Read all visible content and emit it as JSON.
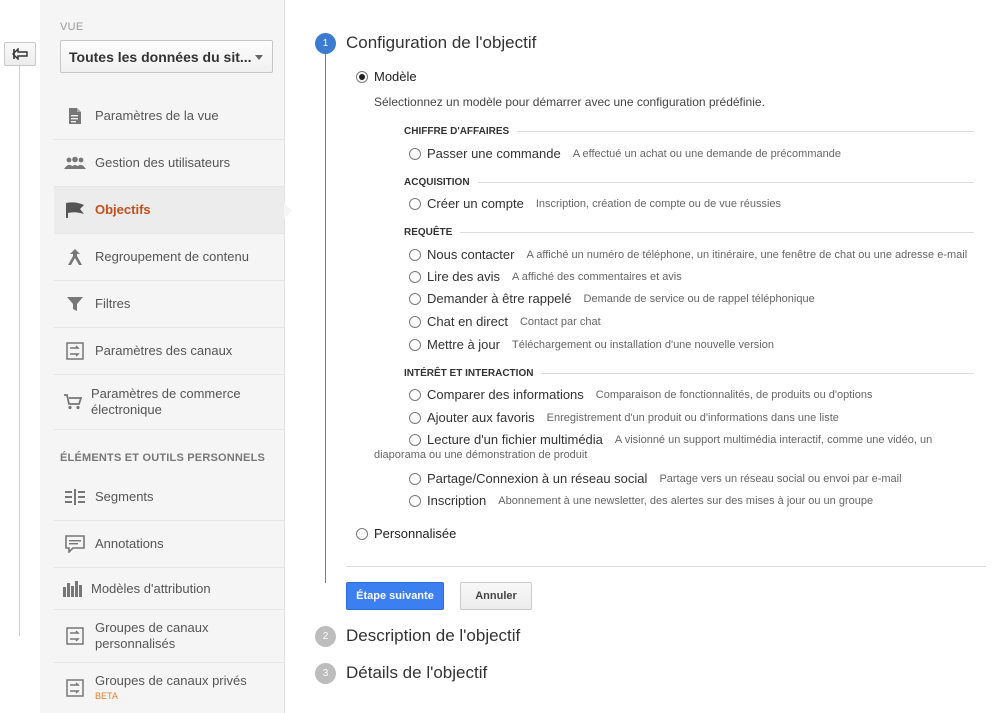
{
  "sidebar": {
    "view_label": "VUE",
    "view_value": "Toutes les données du sit...",
    "items": [
      {
        "label": "Paramètres de la vue",
        "icon": "document-icon"
      },
      {
        "label": "Gestion des utilisateurs",
        "icon": "users-icon"
      },
      {
        "label": "Objectifs",
        "icon": "flag-icon"
      },
      {
        "label": "Regroupement de contenu",
        "icon": "merge-icon"
      },
      {
        "label": "Filtres",
        "icon": "filter-icon"
      },
      {
        "label": "Paramètres des canaux",
        "icon": "channels-icon"
      },
      {
        "label": "Paramètres de commerce électronique",
        "icon": "cart-icon"
      }
    ],
    "section_title": "ÉLÉMENTS ET OUTILS PERSONNELS",
    "tools": [
      {
        "label": "Segments",
        "icon": "segments-icon"
      },
      {
        "label": "Annotations",
        "icon": "annotation-icon"
      },
      {
        "label": "Modèles d'attribution",
        "icon": "bar-chart-icon"
      },
      {
        "label": "Groupes de canaux personnalisés",
        "icon": "channels-icon"
      },
      {
        "label": "Groupes de canaux privés",
        "icon": "channels-icon",
        "badge": "BETA"
      }
    ]
  },
  "steps": [
    {
      "num": "1",
      "title": "Configuration de l'objectif"
    },
    {
      "num": "2",
      "title": "Description de l'objectif"
    },
    {
      "num": "3",
      "title": "Détails de l'objectif"
    }
  ],
  "config": {
    "template_label": "Modèle",
    "intro": "Sélectionnez un modèle pour démarrer avec une configuration prédéfinie.",
    "categories": [
      {
        "title": "CHIFFRE D'AFFAIRES",
        "items": [
          {
            "name": "Passer une commande",
            "desc": "A effectué un achat ou une demande de précommande"
          }
        ]
      },
      {
        "title": "ACQUISITION",
        "items": [
          {
            "name": "Créer un compte",
            "desc": "Inscription, création de compte ou de vue réussies"
          }
        ]
      },
      {
        "title": "REQUÊTE",
        "items": [
          {
            "name": "Nous contacter",
            "desc": "A affiché un numéro de téléphone, un itinéraire, une fenêtre de chat ou une adresse e-mail"
          },
          {
            "name": "Lire des avis",
            "desc": "A affiché des commentaires et avis"
          },
          {
            "name": "Demander à être rappelé",
            "desc": "Demande de service ou de rappel téléphonique"
          },
          {
            "name": "Chat en direct",
            "desc": "Contact par chat"
          },
          {
            "name": "Mettre à jour",
            "desc": "Téléchargement ou installation d'une nouvelle version"
          }
        ]
      },
      {
        "title": "INTÉRÊT ET INTERACTION",
        "items": [
          {
            "name": "Comparer des informations",
            "desc": "Comparaison de fonctionnalités, de produits ou d'options"
          },
          {
            "name": "Ajouter aux favoris",
            "desc": "Enregistrement d'un produit ou d'informations dans une liste"
          },
          {
            "name": "Lecture d'un fichier multimédia",
            "desc": "A visionné un support multimédia interactif, comme une vidéo, un",
            "desc_cont": "diaporama ou une démonstration de produit"
          },
          {
            "name": "Partage/Connexion à un réseau social",
            "desc": "Partage vers un réseau social ou envoi par e-mail"
          },
          {
            "name": "Inscription",
            "desc": "Abonnement à une newsletter, des alertes sur des mises à jour ou un groupe"
          }
        ]
      }
    ],
    "custom_label": "Personnalisée"
  },
  "buttons": {
    "next": "Étape suivante",
    "cancel": "Annuler"
  },
  "colors": {
    "accent": "#3b7bd1",
    "active_nav": "#c24e1c",
    "beta": "#e67e22"
  }
}
